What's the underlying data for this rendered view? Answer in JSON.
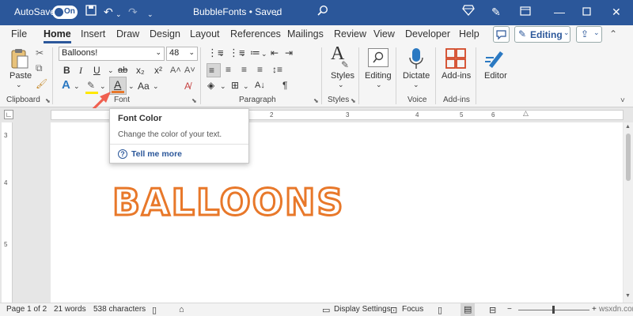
{
  "titlebar": {
    "autosave_label": "AutoSave",
    "autosave_state": "On",
    "doc_title": "BubbleFonts • Saved",
    "accent": "#2b579a"
  },
  "tabs": [
    "File",
    "Home",
    "Insert",
    "Draw",
    "Design",
    "Layout",
    "References",
    "Mailings",
    "Review",
    "View",
    "Developer",
    "Help"
  ],
  "active_tab": "Home",
  "ribbon": {
    "editing_mode": "Editing",
    "font_name": "Balloons!",
    "font_size": "48",
    "groups": {
      "clipboard": "Clipboard",
      "font": "Font",
      "paragraph": "Paragraph",
      "styles": "Styles",
      "voice": "Voice",
      "addins": "Add-ins"
    },
    "buttons": {
      "paste": "Paste",
      "styles": "Styles",
      "editing": "Editing",
      "dictate": "Dictate",
      "addins": "Add-ins",
      "editor": "Editor"
    },
    "format": {
      "bold": "B",
      "italic": "I",
      "underline": "U",
      "strike": "ab",
      "subscript": "x₂",
      "superscript": "x²",
      "change_case": "Aa",
      "font_color_glyph": "A",
      "clear": "A"
    }
  },
  "ruler": [
    "1",
    "2",
    "3",
    "4",
    "5",
    "6"
  ],
  "vruler": [
    "3",
    "4",
    "5"
  ],
  "tooltip": {
    "title": "Font Color",
    "description": "Change the color of your text.",
    "help": "Tell me more"
  },
  "document": {
    "text": "BALLOONS",
    "text_color": "#e8782a"
  },
  "status": {
    "page": "Page 1 of 2",
    "words": "21 words",
    "characters": "538 characters",
    "display_settings": "Display Settings",
    "focus": "Focus",
    "watermark": "wsxdn.com"
  }
}
